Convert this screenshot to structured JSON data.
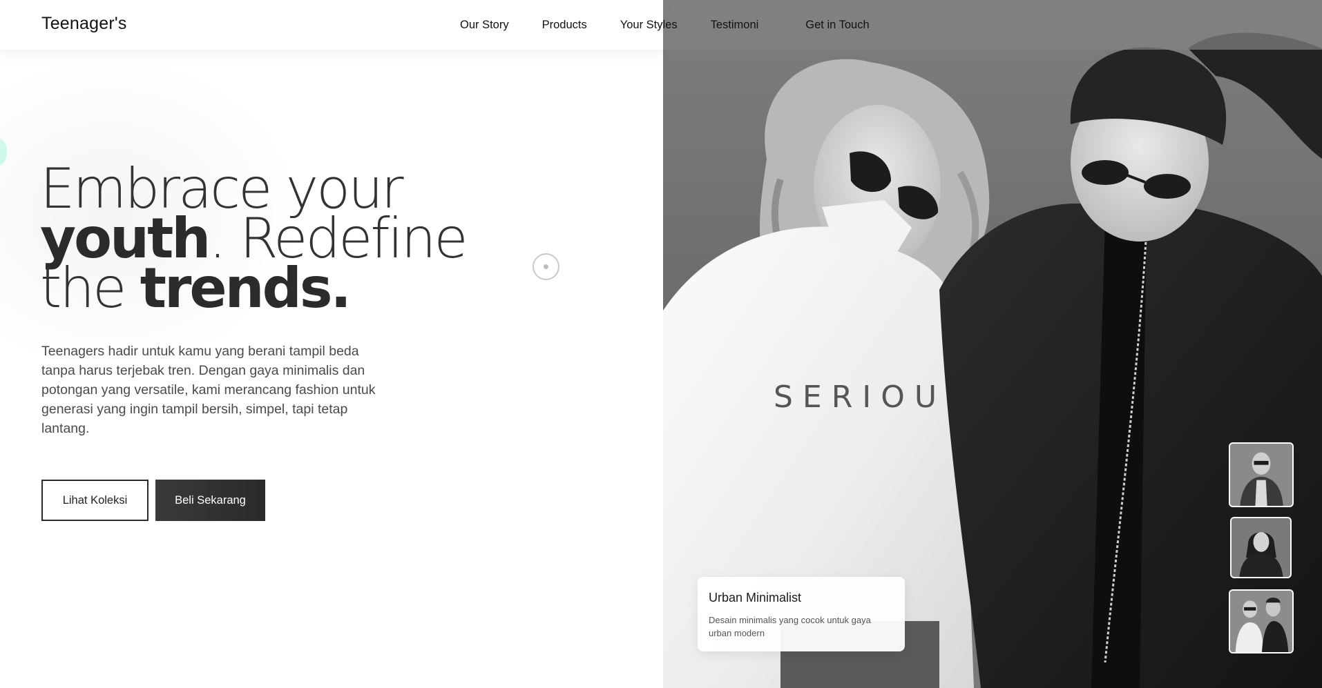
{
  "header": {
    "logo": "Teenager's",
    "nav": [
      {
        "label": "Our Story"
      },
      {
        "label": "Products"
      },
      {
        "label": "Your Styles"
      },
      {
        "label": "Testimoni"
      },
      {
        "label": "Get in Touch"
      }
    ]
  },
  "hero": {
    "headline": {
      "line1_light": "Embrace your",
      "line2_bold": "youth",
      "line2_rest": ". Redefine",
      "line3_light": "the ",
      "line3_bold": "trends."
    },
    "subtext": "Teenagers hadir untuk kamu yang berani tampil beda tanpa harus terjebak tren. Dengan gaya minimalis dan potongan yang versatile, kami merancang fashion untuk generasi yang ingin tampil bersih, simpel, tapi tetap lantang.",
    "buttons": {
      "secondary": "Lihat Koleksi",
      "primary": "Beli Sekarang"
    },
    "photo_text": "SERIOUSLY"
  },
  "card": {
    "title": "Urban Minimalist",
    "description": "Desain minimalis yang cocok untuk gaya urban modern"
  },
  "colors": {
    "accent_dark": "#2a2a2a",
    "header_overlay": "#828282",
    "accent_mint": "#aaf5d7"
  }
}
